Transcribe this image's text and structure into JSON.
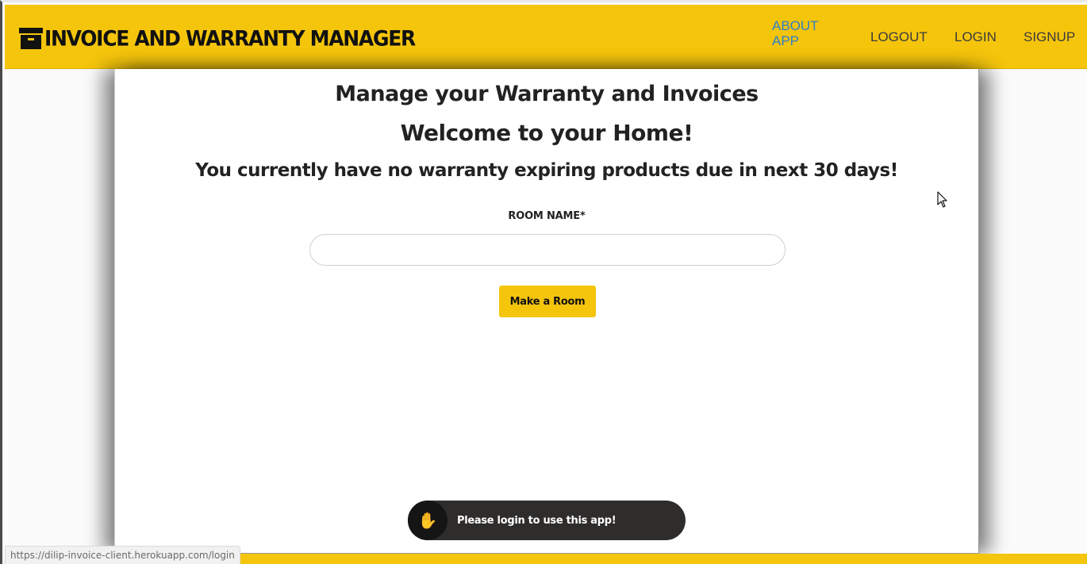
{
  "navbar": {
    "brand": "Invoice and Warranty Manager",
    "brand_icon": "archive-box-icon",
    "links": {
      "about": "ABOUT APP",
      "logout": "LOGOUT",
      "login": "LOGIN",
      "signup": "SIGNUP"
    }
  },
  "main": {
    "heading": "Manage your Warranty and Invoices",
    "welcome": "Welcome to your Home!",
    "notice": "You currently have no warranty expiring products due in next 30 days!",
    "room_form": {
      "label": "ROOM NAME*",
      "value": "",
      "button_label": "Make a Room"
    }
  },
  "toast": {
    "icon": "raised-hand-icon",
    "message": "Please login to use this app!"
  },
  "status_bar": {
    "url": "https://dilip-invoice-client.herokuapp.com/login"
  },
  "colors": {
    "accent": "#f5c50c",
    "link": "#2f7fc6",
    "toast_bg": "#2f2d2c"
  }
}
